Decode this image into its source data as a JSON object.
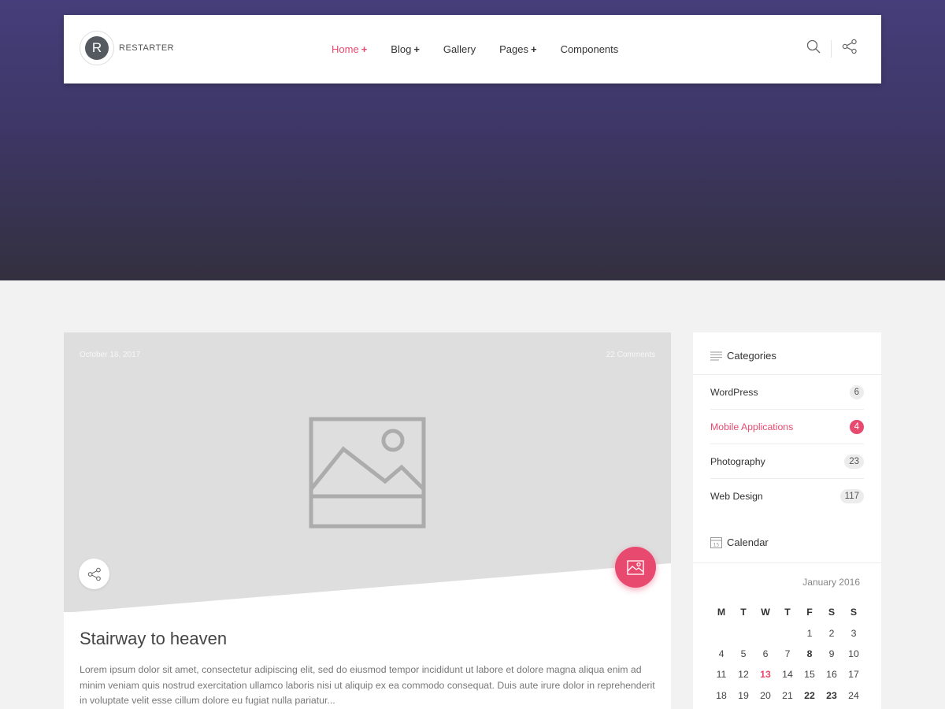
{
  "brand": {
    "logo_letter": "R",
    "name": "RESTARTER"
  },
  "nav": {
    "items": [
      {
        "label": "Home",
        "plus": "+",
        "active": true
      },
      {
        "label": "Blog",
        "plus": "+",
        "active": false
      },
      {
        "label": "Gallery",
        "plus": "",
        "active": false
      },
      {
        "label": "Pages",
        "plus": "+",
        "active": false
      },
      {
        "label": "Components",
        "plus": "",
        "active": false
      }
    ],
    "icons": [
      "search-icon",
      "share-icon"
    ]
  },
  "post": {
    "date": "October 18, 2017",
    "comments": "22 Comments",
    "title": "Stairway to heaven",
    "excerpt": "Lorem ipsum dolor sit amet, consectetur adipiscing elit, sed do eiusmod tempor incididunt ut labore et dolore magna aliqua enim ad minim veniam quis nostrud exercitation ullamco laboris nisi ut aliquip ex ea commodo consequat. Duis aute irure dolor in reprehenderit in voluptate velit esse cillum dolore eu fugiat nulla pariatur...",
    "media_icon": "image-placeholder-icon",
    "format_icon": "image-icon"
  },
  "sidebar": {
    "categories": {
      "title": "Categories",
      "items": [
        {
          "label": "WordPress",
          "count": "6",
          "active": false
        },
        {
          "label": "Mobile Applications",
          "count": "4",
          "active": true
        },
        {
          "label": "Photography",
          "count": "23",
          "active": false
        },
        {
          "label": "Web Design",
          "count": "117",
          "active": false
        }
      ]
    },
    "calendar": {
      "title": "Calendar",
      "month": "January 2016",
      "weekdays": [
        "M",
        "T",
        "W",
        "T",
        "F",
        "S",
        "S"
      ],
      "weeks": [
        [
          "",
          "",
          "",
          "",
          "1",
          "2",
          "3"
        ],
        [
          "4",
          "5",
          "6",
          "7",
          "8",
          "9",
          "10"
        ],
        [
          "11",
          "12",
          "13",
          "14",
          "15",
          "16",
          "17"
        ],
        [
          "18",
          "19",
          "20",
          "21",
          "22",
          "23",
          "24"
        ]
      ],
      "bold_days": [
        "8",
        "22",
        "23"
      ],
      "today": "13"
    }
  },
  "colors": {
    "accent": "#e84a6f",
    "hero_top": "#453e7a",
    "hero_bottom": "#33303f"
  }
}
